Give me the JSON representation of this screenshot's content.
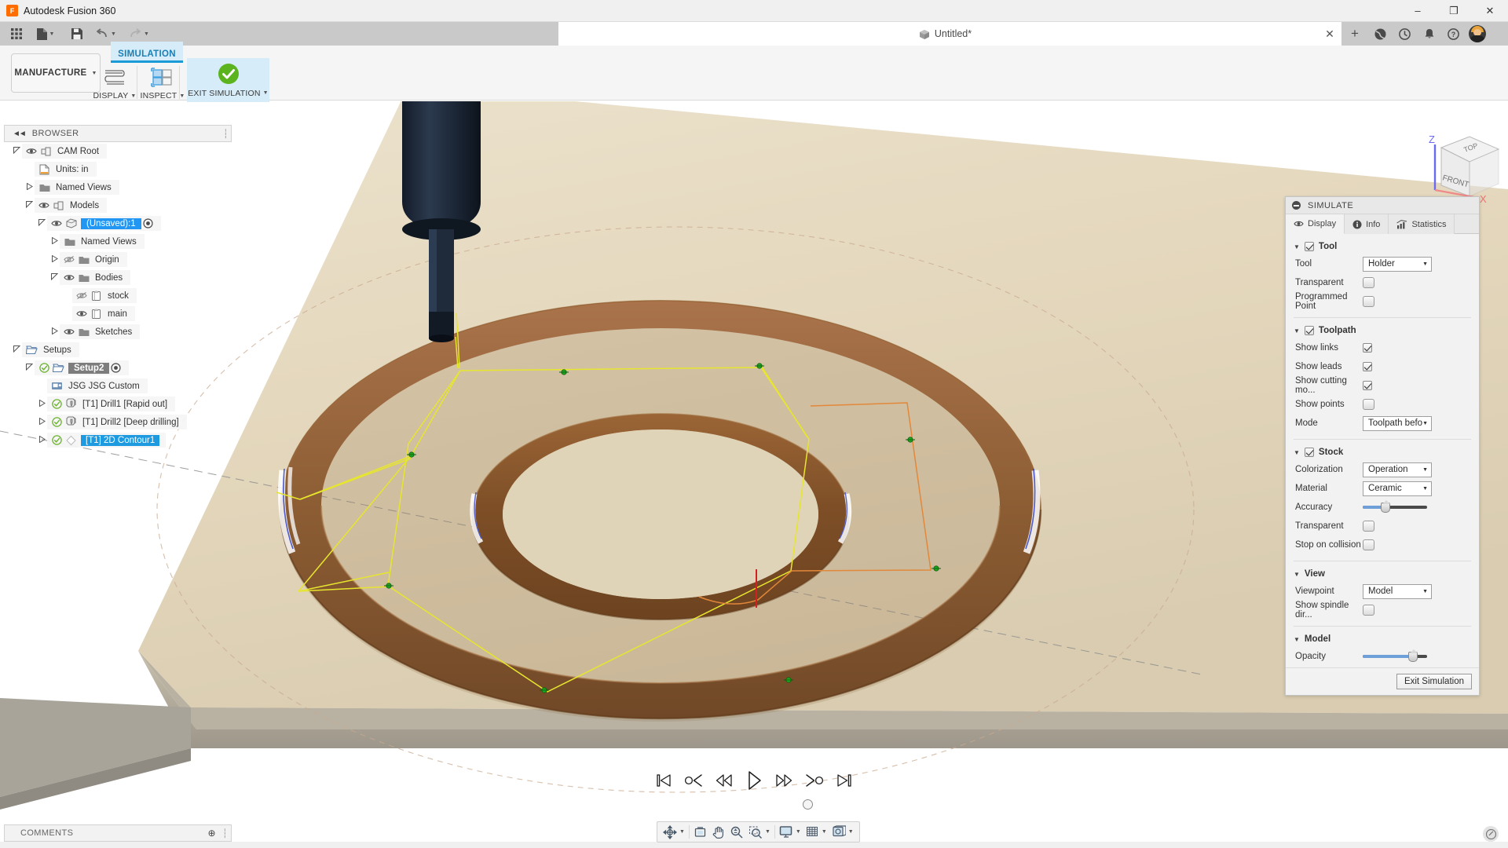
{
  "window": {
    "app_title": "Autodesk Fusion 360",
    "app_icon": "fusion-logo-icon",
    "minimize": "–",
    "maximize": "❐",
    "close": "✕"
  },
  "quick_access": {
    "items": [
      {
        "name": "app-grid-icon",
        "label": ""
      },
      {
        "name": "new-file-icon",
        "label": ""
      },
      {
        "name": "save-icon",
        "label": ""
      },
      {
        "name": "undo-icon",
        "label": ""
      },
      {
        "name": "redo-icon",
        "label": ""
      }
    ]
  },
  "document_tab": {
    "title": "Untitled*",
    "icon": "cube-icon",
    "close_label": "✕",
    "new_tab_label": "+"
  },
  "top_right_icons": [
    {
      "name": "data-panel-icon"
    },
    {
      "name": "job-status-icon"
    },
    {
      "name": "notifications-bell-icon"
    },
    {
      "name": "help-icon"
    },
    {
      "name": "user-avatar"
    }
  ],
  "ribbon": {
    "workspace": "MANUFACTURE",
    "active_tab": "SIMULATION",
    "groups": [
      {
        "label": "DISPLAY",
        "icon": "toolpath-display-icon"
      },
      {
        "label": "INSPECT",
        "icon": "inspect-grid-icon"
      },
      {
        "label": "EXIT SIMULATION",
        "icon": "green-check-icon"
      }
    ]
  },
  "browser": {
    "title": "BROWSER",
    "tree": [
      {
        "label": "CAM Root",
        "indent": 0,
        "arrow": "down",
        "eye": "visible",
        "icon": "cam-root-icon",
        "state": "normal"
      },
      {
        "label": "Units: in",
        "indent": 1,
        "arrow": "none",
        "eye": "none",
        "icon": "units-icon",
        "state": "normal"
      },
      {
        "label": "Named Views",
        "indent": 1,
        "arrow": "right",
        "eye": "none",
        "icon": "folder-icon",
        "state": "normal"
      },
      {
        "label": "Models",
        "indent": 1,
        "arrow": "down",
        "eye": "visible",
        "icon": "component-icon",
        "state": "normal"
      },
      {
        "label": "(Unsaved):1",
        "indent": 2,
        "arrow": "down",
        "eye": "visible",
        "icon": "body-icon",
        "state": "selected-blue",
        "dot": true
      },
      {
        "label": "Named Views",
        "indent": 3,
        "arrow": "right",
        "eye": "none",
        "icon": "folder-icon",
        "state": "normal"
      },
      {
        "label": "Origin",
        "indent": 3,
        "arrow": "right",
        "eye": "hidden",
        "icon": "folder-icon",
        "state": "normal"
      },
      {
        "label": "Bodies",
        "indent": 3,
        "arrow": "down",
        "eye": "visible",
        "icon": "folder-icon",
        "state": "normal"
      },
      {
        "label": "stock",
        "indent": 4,
        "arrow": "none",
        "eye": "hidden",
        "icon": "solid-body-icon",
        "state": "normal"
      },
      {
        "label": "main",
        "indent": 4,
        "arrow": "none",
        "eye": "visible",
        "icon": "solid-body-icon",
        "state": "normal"
      },
      {
        "label": "Sketches",
        "indent": 3,
        "arrow": "right",
        "eye": "visible",
        "icon": "folder-icon",
        "state": "normal"
      },
      {
        "label": "Setups",
        "indent": 0,
        "arrow": "down",
        "eye": "none",
        "icon": "setup-folder-icon",
        "state": "normal"
      },
      {
        "label": "Setup2",
        "indent": 1,
        "arrow": "down",
        "eye": "none",
        "icon": "setup-folder-icon",
        "state": "selected-gray",
        "check": true,
        "dot": true
      },
      {
        "label": "JSG JSG Custom",
        "indent": 2,
        "arrow": "none",
        "eye": "none",
        "icon": "post-process-icon",
        "state": "normal"
      },
      {
        "label": "[T1] Drill1 [Rapid out]",
        "indent": 2,
        "arrow": "right",
        "eye": "none",
        "icon": "drill-op-icon",
        "state": "normal",
        "check": true
      },
      {
        "label": "[T1] Drill2 [Deep drilling]",
        "indent": 2,
        "arrow": "right",
        "eye": "none",
        "icon": "drill-op-icon",
        "state": "normal",
        "check": true
      },
      {
        "label": "[T1] 2D Contour1",
        "indent": 2,
        "arrow": "right",
        "eye": "none",
        "icon": "contour-op-icon",
        "state": "selected-op",
        "check": true
      }
    ]
  },
  "comments": {
    "title": "COMMENTS",
    "add_label": "⊕"
  },
  "simulate_panel": {
    "title": "SIMULATE",
    "tabs": [
      {
        "label": "Display",
        "icon": "eye-icon",
        "active": true
      },
      {
        "label": "Info",
        "icon": "info-icon",
        "active": false
      },
      {
        "label": "Statistics",
        "icon": "bar-chart-icon",
        "active": false
      }
    ],
    "sections": [
      {
        "name": "tool",
        "title": "Tool",
        "checked": true,
        "rows": [
          {
            "label": "Tool",
            "control": "dropdown",
            "value": "Holder"
          },
          {
            "label": "Transparent",
            "control": "toggle",
            "value": false
          },
          {
            "label": "Programmed Point",
            "control": "toggle",
            "value": false
          }
        ]
      },
      {
        "name": "toolpath",
        "title": "Toolpath",
        "checked": true,
        "rows": [
          {
            "label": "Show links",
            "control": "checkbox",
            "value": true
          },
          {
            "label": "Show leads",
            "control": "checkbox",
            "value": true
          },
          {
            "label": "Show cutting mo...",
            "control": "checkbox",
            "value": true
          },
          {
            "label": "Show points",
            "control": "toggle",
            "value": false
          },
          {
            "label": "Mode",
            "control": "dropdown",
            "value": "Toolpath before ..."
          }
        ]
      },
      {
        "name": "stock",
        "title": "Stock",
        "checked": true,
        "rows": [
          {
            "label": "Colorization",
            "control": "dropdown",
            "value": "Operation"
          },
          {
            "label": "Material",
            "control": "dropdown",
            "value": "Ceramic"
          },
          {
            "label": "Accuracy",
            "control": "slider",
            "value": 35
          },
          {
            "label": "Transparent",
            "control": "toggle",
            "value": false
          },
          {
            "label": "Stop on collision",
            "control": "toggle",
            "value": false
          }
        ]
      },
      {
        "name": "view",
        "title": "View",
        "checked": null,
        "rows": [
          {
            "label": "Viewpoint",
            "control": "dropdown",
            "value": "Model"
          },
          {
            "label": "Show spindle dir...",
            "control": "toggle",
            "value": false
          }
        ]
      },
      {
        "name": "model",
        "title": "Model",
        "checked": null,
        "rows": [
          {
            "label": "Opacity",
            "control": "slider",
            "value": 78
          }
        ]
      }
    ],
    "exit_button": "Exit Simulation"
  },
  "playback": {
    "buttons": [
      {
        "name": "skip-to-start-button",
        "icon": "skip-start"
      },
      {
        "name": "step-back-operation-button",
        "icon": "prev-op"
      },
      {
        "name": "fast-rewind-button",
        "icon": "rewind"
      },
      {
        "name": "play-button",
        "icon": "play"
      },
      {
        "name": "fast-forward-button",
        "icon": "forward"
      },
      {
        "name": "step-forward-operation-button",
        "icon": "next-op"
      },
      {
        "name": "skip-to-end-button",
        "icon": "skip-end"
      }
    ],
    "progress_percent": 54
  },
  "navbar": {
    "items": [
      {
        "name": "orbit-icon",
        "has_caret": true
      },
      {
        "name": "fit-icon",
        "has_caret": false
      },
      {
        "name": "pan-icon",
        "has_caret": false
      },
      {
        "name": "zoom-icon",
        "has_caret": false
      },
      {
        "name": "zoom-window-icon",
        "has_caret": true
      },
      {
        "name": "display-settings-icon",
        "has_caret": true
      },
      {
        "name": "grid-snaps-icon",
        "has_caret": true
      },
      {
        "name": "viewports-icon",
        "has_caret": true
      }
    ]
  },
  "viewcube": {
    "top_face": "TOP",
    "front_face": "FRONT",
    "axis_z": "Z",
    "axis_x": "X"
  },
  "colors": {
    "accent_blue": "#1a9ad7",
    "selection_blue": "#2196f3",
    "green_check": "#5bb41e",
    "stock_tan": "#e3d7bd",
    "machined_brown": "#8a5a32",
    "toolpath_yellow": "#e8e83a",
    "lead_orange": "#e08a3c",
    "slider_blue": "#6e9fd8"
  }
}
